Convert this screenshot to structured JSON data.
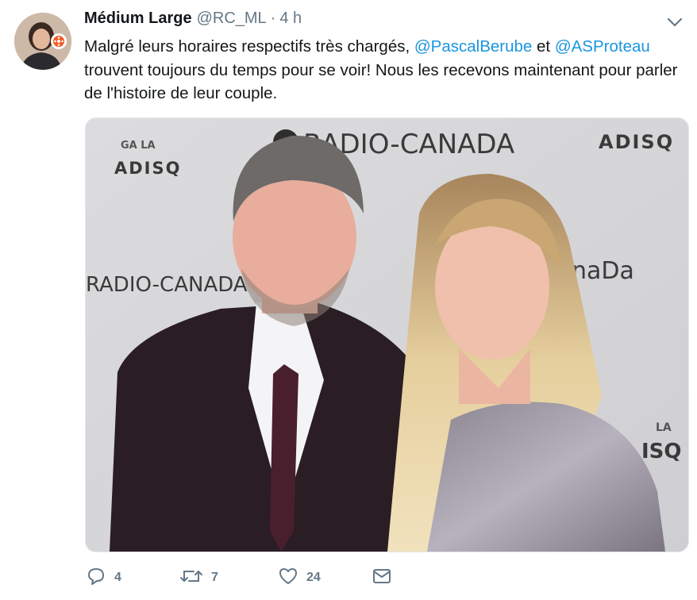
{
  "tweet": {
    "author_name": "Médium Large",
    "handle": "@RC_ML",
    "separator": "·",
    "time": "4 h",
    "text_before": "Malgré leurs horaires respectifs très chargés, ",
    "mention_1": "@PascalBerube",
    "text_between": " et ",
    "mention_2": "@ASProteau",
    "text_after": " trouvent toujours du temps pour se voir! Nous les recevons maintenant pour parler de l'histoire de leur couple."
  },
  "photo": {
    "backdrop_logos": {
      "gala_top": "GA LA",
      "adisq": "ADISQ",
      "radio_canada": "RADIO-CANADA",
      "radio_canada_partial": "naDa",
      "gala_right": "LA",
      "adisq_right": "ISQ"
    }
  },
  "actions": {
    "reply_count": "4",
    "retweet_count": "7",
    "like_count": "24"
  },
  "icons": {
    "reply": "reply-icon",
    "retweet": "retweet-icon",
    "like": "heart-icon",
    "dm": "envelope-icon",
    "more": "chevron-down-icon",
    "badge": "cbc-gem-icon"
  },
  "colors": {
    "text": "#14171a",
    "secondary": "#657786",
    "link": "#1b95e0"
  }
}
